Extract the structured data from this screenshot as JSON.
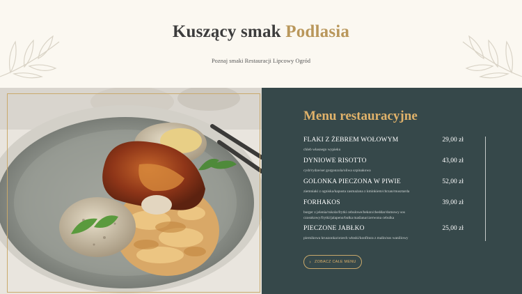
{
  "hero": {
    "title_main": "Kuszący smak",
    "title_accent": "Podlasia",
    "subtitle": "Poznaj smaki Restauracji Lipcowy Ogród"
  },
  "menu": {
    "title": "Menu restauracyjne",
    "items": [
      {
        "name": "FLAKI Z ŻEBREM WOŁOWYM",
        "price": "29,00 zł",
        "desc": "chleb własnego wypieku"
      },
      {
        "name": "DYNIOWE RISOTTO",
        "price": "43,00 zł",
        "desc": "cydr/rydze/ser gorgonzola/oliwa szpinakowa"
      },
      {
        "name": "GOLONKA PIECZONA W PIWIE",
        "price": "52,00 zł",
        "desc": "ziemniaki z ogniska/kapusta zasmażana z kminkiem/chrzan/musztarda"
      },
      {
        "name": "FORHAKOS",
        "price": "39,00 zł",
        "desc": "burger z jelenia/rukola/frytki cebulowe/bekon/cheddar/domowy sos czosnkowy/frytki/jalapeno/bułka maślana/czerwona cebulka"
      },
      {
        "name": "PIECZONE JABŁKO",
        "price": "25,00 zł",
        "desc": "piernikowa kruszonka/orzech włoski/konfitura z malin/sos waniliowy"
      }
    ],
    "cta_label": "ZOBACZ CAŁE MENU"
  },
  "colors": {
    "accent": "#b9975b",
    "panel": "#36484a",
    "menu_title": "#e0b26a"
  }
}
